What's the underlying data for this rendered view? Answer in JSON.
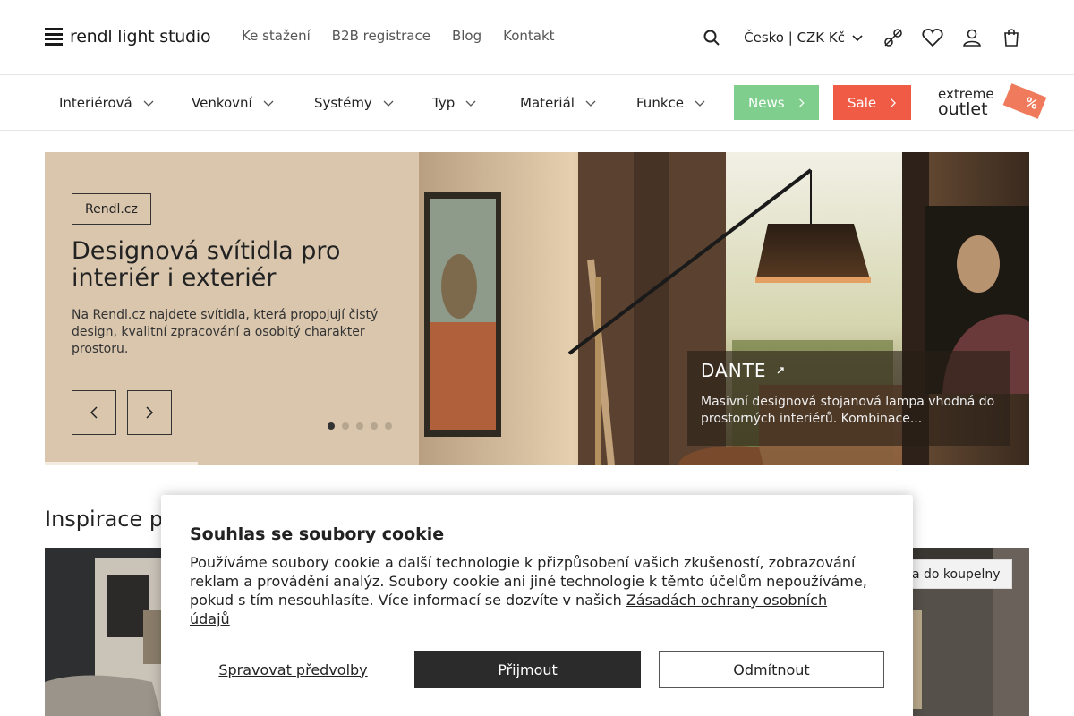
{
  "header": {
    "logo_text": "rendl light studio",
    "nav": [
      "Ke stažení",
      "B2B registrace",
      "Blog",
      "Kontakt"
    ],
    "locale": "Česko | CZK Kč",
    "icons": [
      "search-icon",
      "compare-icon",
      "heart-icon",
      "user-icon",
      "cart-icon"
    ]
  },
  "category_nav": {
    "items": [
      "Interiérová",
      "Venkovní",
      "Systémy",
      "Typ",
      "Materiál",
      "Funkce"
    ],
    "news_label": "News",
    "sale_label": "Sale",
    "outlet_line1": "extreme",
    "outlet_line2": "outlet",
    "outlet_tag": "%",
    "colors": {
      "news": "#7fce8e",
      "sale": "#ef5b45"
    }
  },
  "hero": {
    "chip": "Rendl.cz",
    "title": "Designová svítidla pro interiér i exteriér",
    "description": "Na Rendl.cz najdete svítidla, která propojují čistý design, kvalitní zpracování a osobitý charakter prostoru.",
    "slides_total": 5,
    "active_slide": 1,
    "product": {
      "name": "DANTE",
      "description": "Masivní designová stojanová lampa vhodná do prostorných interiérů. Kombinace..."
    }
  },
  "inspiration": {
    "title": "Inspirace p",
    "chip": "a do koupelny"
  },
  "cookie": {
    "title": "Souhlas se soubory cookie",
    "text": "Používáme soubory cookie a další technologie k přizpůsobení vašich zkušeností, zobrazování reklam a provádění analýz. Soubory cookie ani jiné technologie k těmto účelům nepoužíváme, pokud s tím nesouhlasíte. Více informací se dozvíte v našich",
    "link": "Zásadách ochrany osobních údajů",
    "manage_label": "Spravovat předvolby",
    "accept_label": "Přijmout",
    "reject_label": "Odmítnout"
  }
}
